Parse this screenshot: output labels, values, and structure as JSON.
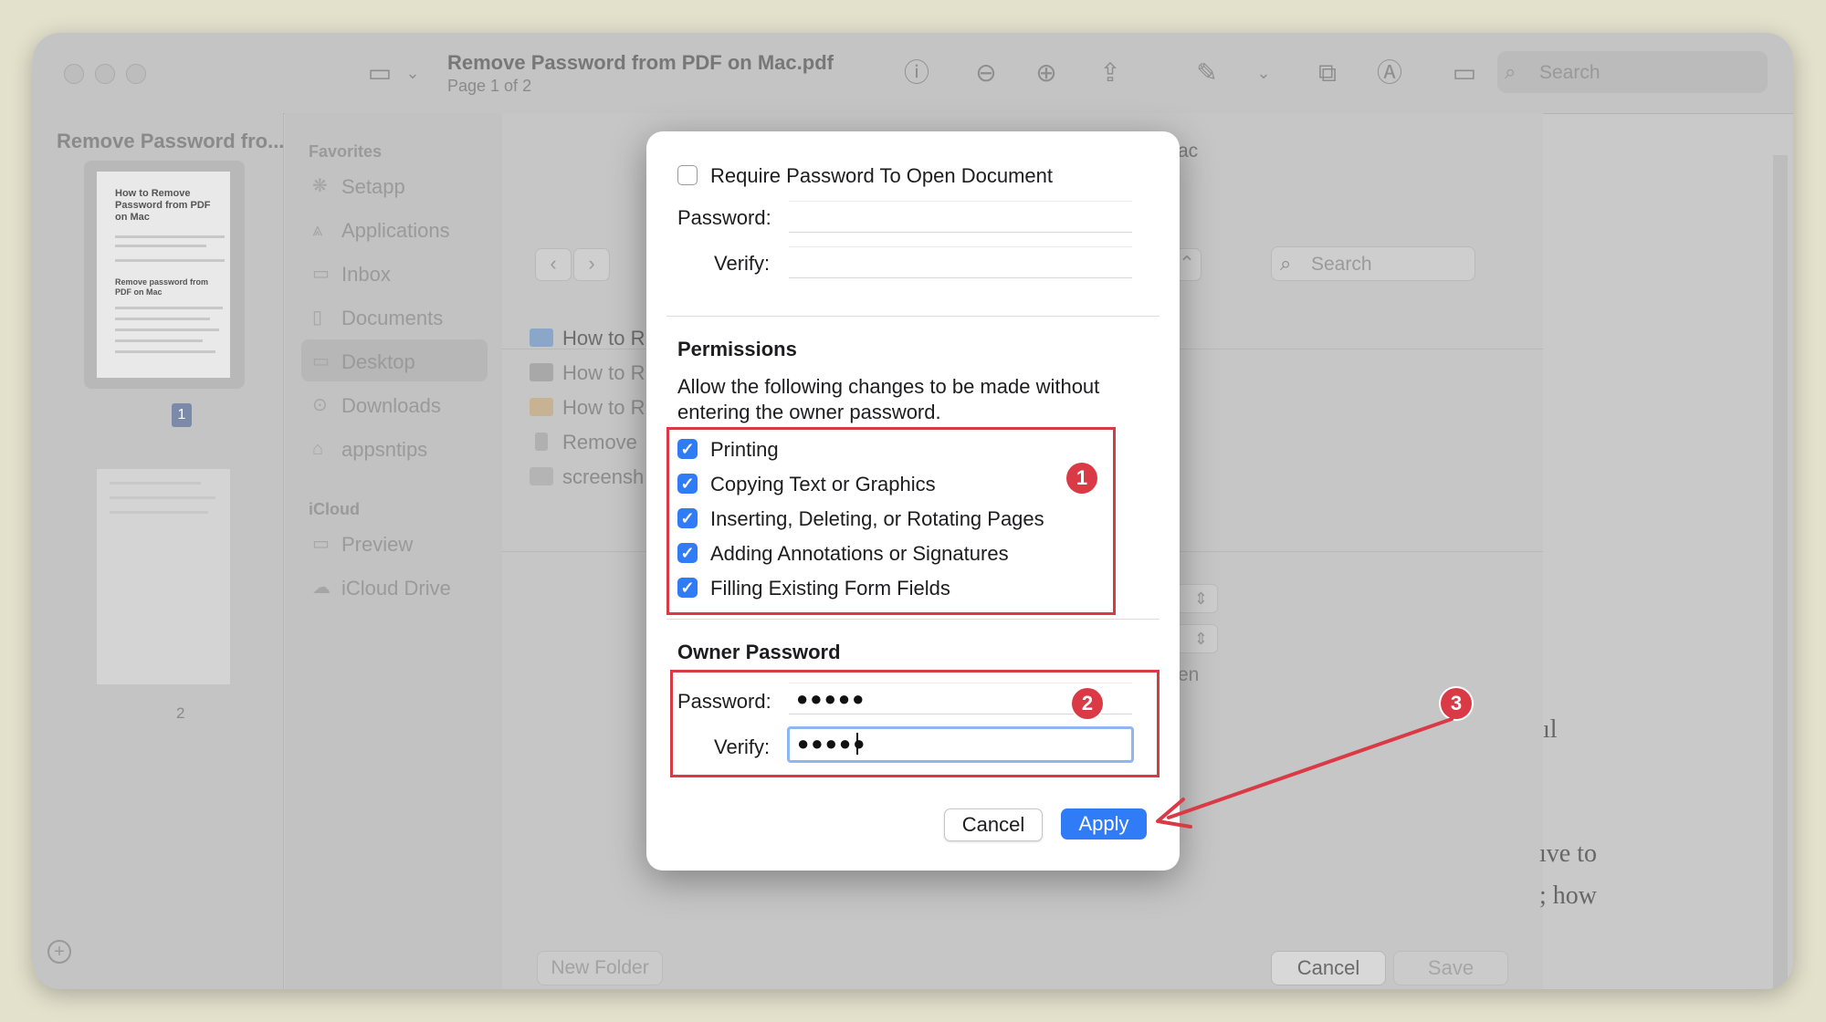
{
  "colors": {
    "accent": "#2f7cf6",
    "annotation": "#d93a45",
    "background": "#e3e0cc"
  },
  "toolbar": {
    "title": "Remove Password from PDF on Mac.pdf",
    "subtitle": "Page 1 of 2",
    "search_placeholder": "Search",
    "icons": [
      "sidebar-icon",
      "info-icon",
      "zoom-out-icon",
      "zoom-in-icon",
      "share-icon",
      "markup-pen-icon",
      "rotate-icon",
      "annotate-icon",
      "signature-icon"
    ]
  },
  "sidebar": {
    "title": "Remove Password fro...",
    "thumb_title": "How to Remove Password from PDF on Mac",
    "thumb_heading": "Remove password from PDF on Mac",
    "pages": [
      "1",
      "2"
    ]
  },
  "save_panel": {
    "favorites_header": "Favorites",
    "favorites": [
      "Setapp",
      "Applications",
      "Inbox",
      "Documents",
      "Desktop",
      "Downloads",
      "appsntips"
    ],
    "icloud_header": "iCloud",
    "icloud": [
      "Preview",
      "iCloud Drive"
    ],
    "search_placeholder": "Search",
    "files": [
      "How to R",
      "How to R",
      "How to R",
      "Remove",
      "screensh"
    ],
    "tag_stub": "ac",
    "en_stub": "en",
    "new_folder": "New Folder",
    "cancel": "Cancel",
    "save": "Save"
  },
  "background_doc": {
    "line1": "ıl",
    "line2": "ıve to",
    "line3": "; how"
  },
  "dialog": {
    "require_password_label": "Require Password To Open Document",
    "require_password_checked": false,
    "password_label": "Password:",
    "verify_label": "Verify:",
    "permissions_heading": "Permissions",
    "permissions_desc": "Allow the following changes to be made without entering the owner password.",
    "permissions": [
      {
        "label": "Printing",
        "checked": true
      },
      {
        "label": "Copying Text or Graphics",
        "checked": true
      },
      {
        "label": "Inserting, Deleting, or Rotating Pages",
        "checked": true
      },
      {
        "label": "Adding Annotations or Signatures",
        "checked": true
      },
      {
        "label": "Filling Existing Form Fields",
        "checked": true
      }
    ],
    "owner_heading": "Owner Password",
    "owner_password_value": "●●●●●",
    "owner_verify_value": "●●●●●",
    "cancel": "Cancel",
    "apply": "Apply"
  },
  "annotations": {
    "markers": [
      "1",
      "2",
      "3"
    ]
  }
}
